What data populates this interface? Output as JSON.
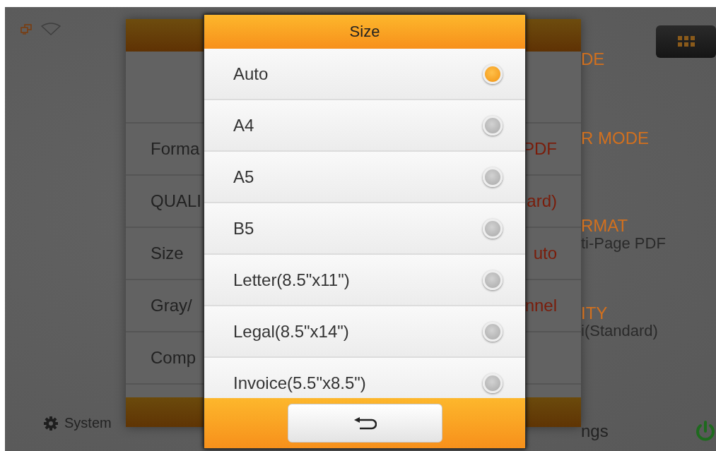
{
  "background_panel": {
    "rows": [
      {
        "label": "Forma",
        "value": "PDF"
      },
      {
        "label": "QUALI",
        "value": "ard)"
      },
      {
        "label": "Size",
        "value": "uto"
      },
      {
        "label": "Gray/",
        "value": "nnel"
      },
      {
        "label": "Comp"
      }
    ]
  },
  "left_footer": {
    "label": "System"
  },
  "right_column": [
    {
      "title": "DE"
    },
    {
      "title": "R MODE"
    },
    {
      "title": "RMAT",
      "value": "ti-Page PDF"
    },
    {
      "title": "ITY",
      "value": "i(Standard)"
    }
  ],
  "right_footer": {
    "label": "ngs"
  },
  "dialog": {
    "title": "Size",
    "options": [
      {
        "label": "Auto",
        "selected": true
      },
      {
        "label": "A4",
        "selected": false
      },
      {
        "label": "A5",
        "selected": false
      },
      {
        "label": "B5",
        "selected": false
      },
      {
        "label": "Letter(8.5\"x11\")",
        "selected": false
      },
      {
        "label": "Legal(8.5\"x14\")",
        "selected": false
      },
      {
        "label": "Invoice(5.5\"x8.5\")",
        "selected": false
      }
    ]
  }
}
